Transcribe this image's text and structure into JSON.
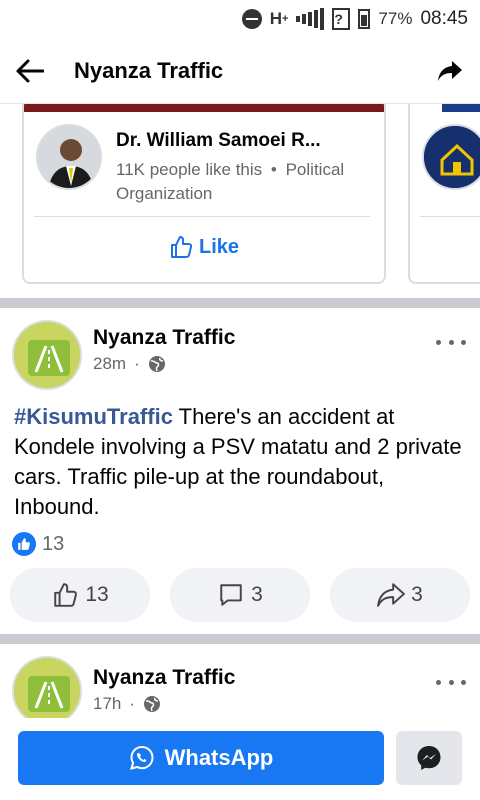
{
  "status_bar": {
    "network": "H",
    "network_sup": "+",
    "battery": "77%",
    "time": "08:45",
    "icons": [
      "do-not-disturb-icon",
      "signal-icon",
      "no-sim-icon",
      "battery-icon"
    ]
  },
  "header": {
    "title": "Nyanza Traffic",
    "back_icon": "arrow-left-icon",
    "share_icon": "share-icon"
  },
  "suggested_page": {
    "name": "Dr. William Samoei R...",
    "likes_text": "11K people like this",
    "separator": "•",
    "category": "Political Organization",
    "like_label": "Like"
  },
  "posts": [
    {
      "author": "Nyanza Traffic",
      "time": "28m",
      "dot": "·",
      "hashtag": "#KisumuTraffic",
      "text": " There's an accident at Kondele involving a PSV matatu and 2 private cars. Traffic pile-up at the roundabout, Inbound.",
      "reaction_count": "13",
      "likes": "13",
      "comments": "3",
      "shares": "3"
    },
    {
      "author": "Nyanza Traffic",
      "time": "17h",
      "dot": "·"
    }
  ],
  "bottom": {
    "whatsapp_label": "WhatsApp",
    "whatsapp_icon": "whatsapp-icon",
    "messenger_icon": "messenger-icon"
  },
  "colors": {
    "primary_blue": "#1877f2",
    "like_blue": "#1b74e4",
    "hashtag": "#385898",
    "secondary_text": "#65676b",
    "separator": "#c9ccd1"
  }
}
